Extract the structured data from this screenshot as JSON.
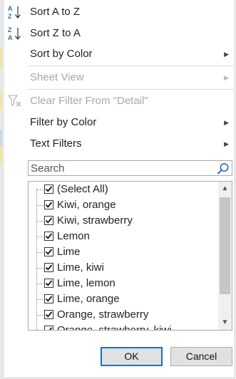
{
  "menu": {
    "sort_az": {
      "label": "Sort A to Z",
      "icon": "sort-az-icon"
    },
    "sort_za": {
      "label": "Sort Z to A",
      "icon": "sort-za-icon"
    },
    "sort_by_color": {
      "label": "Sort by Color"
    },
    "sheet_view": {
      "label": "Sheet View"
    },
    "clear_filter": {
      "label": "Clear Filter From \"Detail\"",
      "icon": "clear-filter-icon"
    },
    "filter_by_color": {
      "label": "Filter by Color"
    },
    "text_filters": {
      "label": "Text Filters"
    }
  },
  "search": {
    "placeholder": "Search"
  },
  "list": {
    "items": [
      {
        "label": "(Select All)",
        "checked": true
      },
      {
        "label": "Kiwi, orange",
        "checked": true
      },
      {
        "label": "Kiwi, strawberry",
        "checked": true
      },
      {
        "label": "Lemon",
        "checked": true
      },
      {
        "label": "Lime",
        "checked": true
      },
      {
        "label": "Lime, kiwi",
        "checked": true
      },
      {
        "label": "Lime, lemon",
        "checked": true
      },
      {
        "label": "Lime, orange",
        "checked": true
      },
      {
        "label": "Orange, strawberry",
        "checked": true
      },
      {
        "label": "Orange, strawberry, kiwi",
        "checked": true
      }
    ]
  },
  "buttons": {
    "ok": "OK",
    "cancel": "Cancel"
  },
  "colors": {
    "accent": "#0078d7",
    "sort_icon_blue": "#2b6cb0",
    "disabled_text": "#a8a8a8"
  }
}
